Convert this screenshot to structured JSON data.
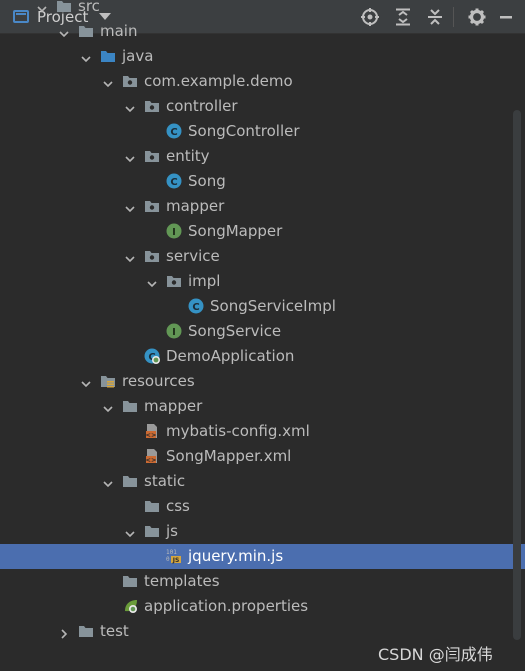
{
  "header": {
    "title": "Project",
    "icons": [
      "project-view-icon",
      "locate-icon",
      "expand-all-icon",
      "collapse-all-icon",
      "settings-icon",
      "hide-icon"
    ]
  },
  "tree": [
    {
      "label": "src",
      "icon": "folder-icon",
      "expanded": true
    },
    {
      "label": "main",
      "icon": "folder-icon",
      "expanded": true
    },
    {
      "label": "java",
      "icon": "source-folder-icon",
      "expanded": true
    },
    {
      "label": "com.example.demo",
      "icon": "package-icon",
      "expanded": true
    },
    {
      "label": "controller",
      "icon": "package-icon",
      "expanded": true
    },
    {
      "label": "SongController",
      "icon": "class-icon"
    },
    {
      "label": "entity",
      "icon": "package-icon",
      "expanded": true
    },
    {
      "label": "Song",
      "icon": "class-icon"
    },
    {
      "label": "mapper",
      "icon": "package-icon",
      "expanded": true
    },
    {
      "label": "SongMapper",
      "icon": "interface-icon"
    },
    {
      "label": "service",
      "icon": "package-icon",
      "expanded": true
    },
    {
      "label": "impl",
      "icon": "package-icon",
      "expanded": true
    },
    {
      "label": "SongServiceImpl",
      "icon": "class-icon"
    },
    {
      "label": "SongService",
      "icon": "interface-icon"
    },
    {
      "label": "DemoApplication",
      "icon": "spring-boot-class-icon"
    },
    {
      "label": "resources",
      "icon": "resources-folder-icon",
      "expanded": true
    },
    {
      "label": "mapper",
      "icon": "folder-icon",
      "expanded": true
    },
    {
      "label": "mybatis-config.xml",
      "icon": "xml-file-icon"
    },
    {
      "label": "SongMapper.xml",
      "icon": "xml-file-icon"
    },
    {
      "label": "static",
      "icon": "folder-icon",
      "expanded": true
    },
    {
      "label": "css",
      "icon": "folder-icon"
    },
    {
      "label": "js",
      "icon": "folder-icon",
      "expanded": true
    },
    {
      "label": "jquery.min.js",
      "icon": "js-file-icon",
      "selected": true
    },
    {
      "label": "templates",
      "icon": "folder-icon"
    },
    {
      "label": "application.properties",
      "icon": "spring-properties-icon"
    },
    {
      "label": "test",
      "icon": "folder-icon",
      "expanded": false
    }
  ],
  "watermark": "CSDN @闫成伟",
  "colors": {
    "background": "#2b2b2b",
    "header": "#3c3f41",
    "selection": "#4b6eaf",
    "folder": "#87939a",
    "class": "#3592c4",
    "interface": "#629755",
    "xml": "#cc6a32",
    "js": "#d5a63e"
  }
}
